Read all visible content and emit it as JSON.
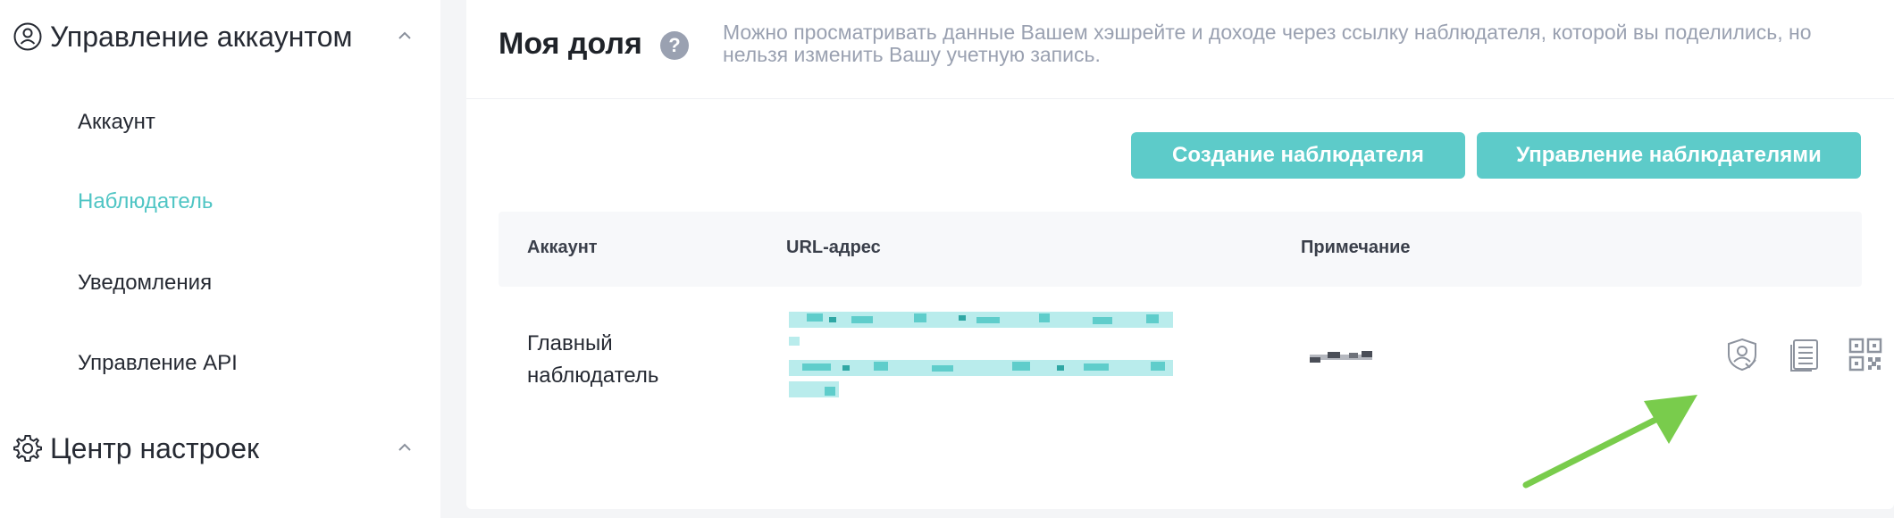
{
  "sidebar": {
    "groups": [
      {
        "label": "Управление аккаунтом",
        "icon": "user-circle-icon",
        "items": [
          {
            "label": "Аккаунт",
            "active": false
          },
          {
            "label": "Наблюдатель",
            "active": true
          },
          {
            "label": "Уведомления",
            "active": false
          },
          {
            "label": "Управление API",
            "active": false
          }
        ]
      },
      {
        "label": "Центр настроек",
        "icon": "gear-icon",
        "items": []
      }
    ]
  },
  "main": {
    "title": "Моя доля",
    "help_icon": "question-mark-icon",
    "description": "Можно просматривать данные Вашем хэшрейте и доходе через ссылку наблюдателя, которой вы поделились, но нельзя изменить Вашу учетную запись.",
    "buttons": {
      "create": "Создание наблюдателя",
      "manage": "Управление наблюдателями"
    },
    "table": {
      "columns": [
        "Аккаунт",
        "URL-адрес",
        "Примечание"
      ],
      "rows": [
        {
          "account": "Главный наблюдатель",
          "actions": [
            "shield-user-icon",
            "copy-document-icon",
            "qr-code-icon"
          ]
        }
      ]
    }
  },
  "colors": {
    "accent": "#5dcbc9",
    "active_text": "#4fc5c4",
    "muted_text": "#9aa1b1",
    "arrow": "#79cc4c",
    "page_bg": "#f4f5f7"
  }
}
